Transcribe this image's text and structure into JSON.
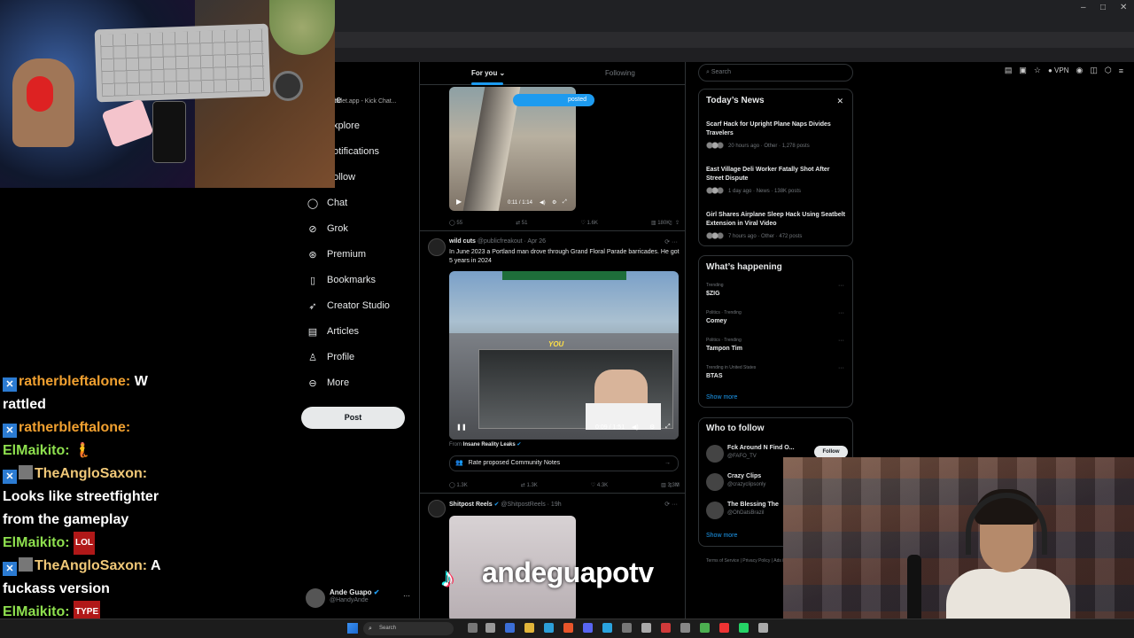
{
  "browser": {
    "tab_text": "icklet.app - Kick Chat...",
    "vpn_label": "VPN",
    "window_controls": [
      "–",
      "□",
      "✕"
    ]
  },
  "x_nav": {
    "items": [
      {
        "icon": "home-icon",
        "label": "ome"
      },
      {
        "icon": "explore-icon",
        "label": "xplore"
      },
      {
        "icon": "bell-icon",
        "label": "otifications"
      },
      {
        "icon": "follow-icon",
        "label": "ollow"
      },
      {
        "icon": "chat-icon",
        "label": "Chat"
      },
      {
        "icon": "grok-icon",
        "label": "Grok"
      },
      {
        "icon": "premium-icon",
        "label": "Premium"
      },
      {
        "icon": "bookmark-icon",
        "label": "Bookmarks"
      },
      {
        "icon": "rocket-icon",
        "label": "Creator Studio"
      },
      {
        "icon": "article-icon",
        "label": "Articles"
      },
      {
        "icon": "profile-icon",
        "label": "Profile"
      },
      {
        "icon": "more-icon",
        "label": "More"
      }
    ],
    "post_button": "Post",
    "account": {
      "name": "Ande Guapo",
      "handle": "@HandyAnde"
    }
  },
  "feed": {
    "tabs": [
      "For you ⌄",
      "Following"
    ],
    "posted_pill": "posted",
    "post1": {
      "video_time": "0:11 / 1:14",
      "stats": {
        "replies": "55",
        "reposts": "51",
        "likes": "1.6K",
        "views": "180K"
      }
    },
    "post2": {
      "name": "wild cuts",
      "handle": "@publicfreakout · Apr 26",
      "text": "In June 2023 a Portland man drove through Grand Floral Parade barricades. He got 5 years in 2024",
      "video_label": "YOU",
      "video_time": "0:09 / 1:51",
      "from_label": "From",
      "from_source": "Insane Reality Leaks",
      "community_notes": "Rate proposed Community Notes",
      "stats": {
        "replies": "1.3K",
        "reposts": "1.3K",
        "likes": "4.3K",
        "views": "3.3M"
      }
    },
    "post3": {
      "name": "Shitpost Reels",
      "handle": "@ShitpostReels · 19h"
    }
  },
  "right": {
    "search_placeholder": "Search",
    "news_title": "Today’s News",
    "news": [
      {
        "headline": "Scarf Hack for Upright Plane Naps Divides Travelers",
        "meta": "20 hours ago · Other · 1,278 posts"
      },
      {
        "headline": "East Village Deli Worker Fatally Shot After Street Dispute",
        "meta": "1 day ago · News · 138K posts"
      },
      {
        "headline": "Girl Shares Airplane Sleep Hack Using Seatbelt Extension in Viral Video",
        "meta": "7 hours ago · Other · 472 posts"
      }
    ],
    "happening_title": "What’s happening",
    "trends": [
      {
        "meta": "Trending",
        "name": "$ZIG"
      },
      {
        "meta": "Politics · Trending",
        "name": "Comey"
      },
      {
        "meta": "Politics · Trending",
        "name": "Tampon Tim"
      },
      {
        "meta": "Trending in United States",
        "name": "BTAS"
      }
    ],
    "show_more": "Show more",
    "who_title": "Who to follow",
    "who": [
      {
        "name": "Fck Around N Find O...",
        "handle": "@FAFO_TV",
        "button": "Follow"
      },
      {
        "name": "Crazy Clips",
        "handle": "@crazyclipsonly",
        "button": ""
      },
      {
        "name": "The Blessing The",
        "handle": "@OhDatsBrazil",
        "button": ""
      }
    ],
    "show_more_2": "Show more",
    "footer": "Terms of Service  |  Privacy Policy  |  Ads info  |  More"
  },
  "chat": [
    {
      "user": "ratherbleftalone:",
      "color": "orange",
      "text": " W rattled"
    },
    {
      "user": "ratherbleftalone:",
      "color": "orange",
      "text": ""
    },
    {
      "user": "ElMaikito:",
      "color": "green",
      "text": " 🧜"
    },
    {
      "user": "TheAngloSaxon:",
      "color": "gold",
      "text": " Looks like streetfighter from the gameplay"
    },
    {
      "user": "ElMaikito:",
      "color": "green",
      "text": ""
    },
    {
      "user": "TheAngloSaxon:",
      "color": "gold",
      "text": " A fuckass version"
    },
    {
      "user": "ElMaikito:",
      "color": "green",
      "text": ""
    }
  ],
  "chat_emotes": {
    "maikito_2": "LOL",
    "maikito_3": "TYPE"
  },
  "watermark": "andeguapotv",
  "taskbar": {
    "search": "Search"
  },
  "colors": {
    "accent": "#1d9bf0",
    "background": "#000000",
    "orange_user": "#f0a030",
    "green_user": "#8ee04e"
  }
}
